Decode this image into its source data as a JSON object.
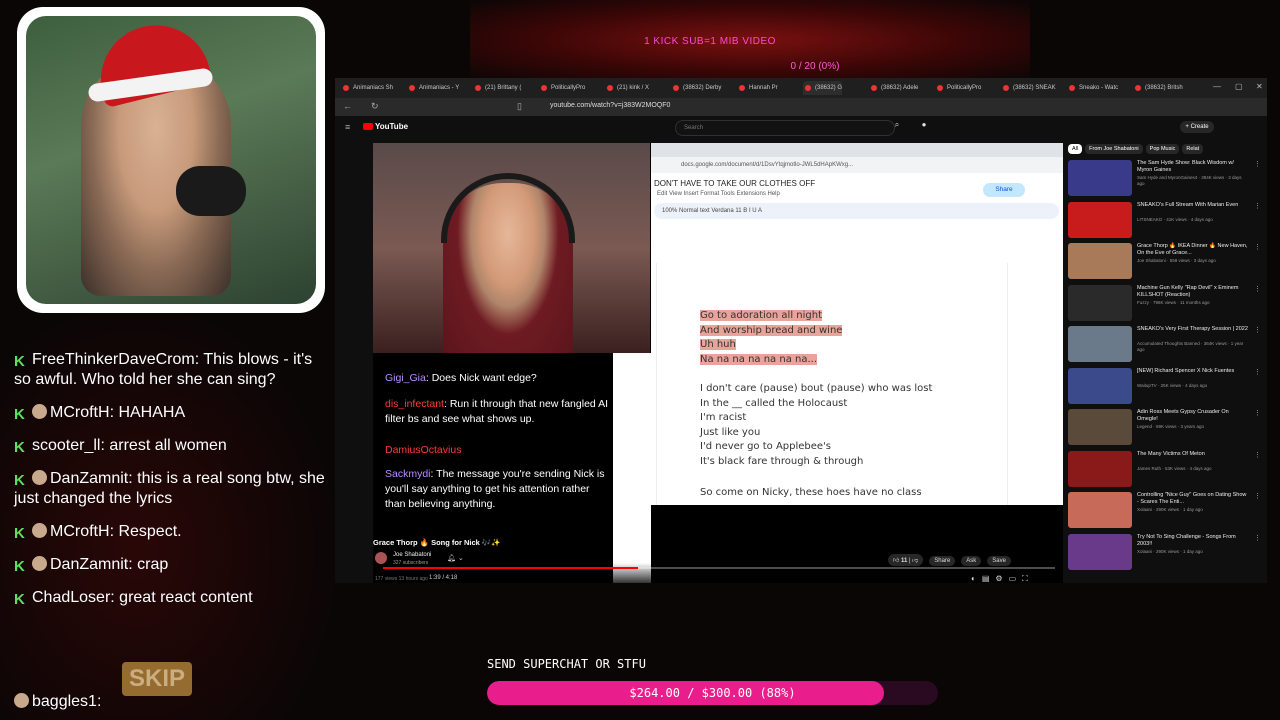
{
  "overlay": {
    "banner": "1 KICK SUB=1 MIB VIDEO",
    "sub_goal": "0 / 20 (0%)"
  },
  "chat": [
    {
      "user": "FreeThinkerDaveCrom",
      "text": "This blows - it's so awful. Who told her she can sing?"
    },
    {
      "user": "MCroftH",
      "text": "HAHAHA"
    },
    {
      "user": "scooter_ll",
      "text": "arrest all women"
    },
    {
      "user": "DanZamnit",
      "text": "this is a real song btw, she just changed the lyrics"
    },
    {
      "user": "MCroftH",
      "text": "Respect."
    },
    {
      "user": "DanZamnit",
      "text": "crap"
    },
    {
      "user": "ChadLoser",
      "text": "great react content"
    }
  ],
  "skip_label": "SKIP",
  "last_user": "baggles1:",
  "browser": {
    "tabs": [
      "Animaniacs Sh",
      "Animaniacs - Y",
      "(21) Brittany (",
      "PoliticallyPro",
      "(21) kink / X",
      "(38632) Derby",
      "Hannah Pr",
      "(38632) G",
      "(38632) Adele",
      "PoliticallyPro",
      "(38632) SNEAK",
      "Sneako - Watc",
      "(38632) Britsh"
    ],
    "url": "youtube.com/watch?v=j383W2MOQF0",
    "search_placeholder": "Search",
    "create_label": "+ Create"
  },
  "youtube_logo": "YouTube",
  "stream_chat": [
    {
      "user": "Gigi_Gia",
      "text": "Does Nick want edge?",
      "red": false
    },
    {
      "user": "dis_infectant",
      "text": "Run it through that new fangled AI filter bs and see what shows up.",
      "red": true
    },
    {
      "user": "DamiusOctavius",
      "text": "",
      "red": true
    },
    {
      "user": "Sackmydi",
      "text": "The message you're sending Nick is you'll say anything to get his attention rather than believing anything.",
      "red": false
    }
  ],
  "doc": {
    "url": "docs.google.com/document/d/1DsvYtqjmotlo-JWL5dHApKWxg...",
    "title": "DON'T HAVE TO TAKE OUR CLOTHES OFF",
    "menu": "Edit   View   Insert   Format   Tools   Extensions   Help",
    "share": "Share",
    "toolbar": "100%   Normal text   Verdana   11   B   I   U   A",
    "lyrics_highlighted": [
      "Go to adoration all night",
      "And worship bread and wine",
      "Uh huh",
      "Na na na na na na na..."
    ],
    "lyrics_plain": [
      "I don't care (pause) bout (pause) who was lost",
      "In the __ called the Holocaust",
      "I'm racist",
      "Just like you",
      "I'd never go to Applebee's",
      "It's black fare through & through"
    ],
    "lyrics_last": "So come on Nicky, these hoes have no class"
  },
  "video": {
    "time": "1:39 / 4:18",
    "progress": 0.38,
    "title": "Grace Thorp 🔥 Song for Nick 🎶✨",
    "channel": "Joe Shabatoni",
    "subs": "327 subscribers",
    "likes": "11",
    "actions": [
      "Share",
      "Ask",
      "Save"
    ],
    "views": "177 views  13 hours ago"
  },
  "sidebar": {
    "chips": [
      "All",
      "From Joe Shabatoni",
      "Pop Music",
      "Relat"
    ],
    "items": [
      {
        "title": "The Sam Hyde Show: Black Wisdom w/ Myron Gaines",
        "meta": "Sam Hyde and MyronGaines4 · 394K views · 3 days ago",
        "color": "#3a3a8a"
      },
      {
        "title": "SNEAKO's Full Stream With Marian Even",
        "meta": "LITSNEAKO · 41K views · 4 days ago",
        "color": "#c81c1c"
      },
      {
        "title": "Grace Thorp 🔥 IKEA Dinner 🔥 New Haven, On the Eve of Grace...",
        "meta": "Joe Shabatoni · 559 views · 3 days ago",
        "color": "#a87a5a"
      },
      {
        "title": "Machine Gun Kelly \"Rap Devil\" x Eminem KILLSHOT (Reaction)",
        "meta": "Fuzzy · 796K views · 11 months ago",
        "color": "#2a2a2a"
      },
      {
        "title": "SNEAKO's Very First Therapy Session | 2022",
        "meta": "Accumulated Thoughts Banned · 364K views · 1 year ago",
        "color": "#6a7a8a"
      },
      {
        "title": "[NEW] Richard Spencer X Nick Fuentes",
        "meta": "WaitupTV · 25K views · 4 days ago",
        "color": "#3a4a8a"
      },
      {
        "title": "Adin Ross Meets Gypsy Crusader On Omegle!",
        "meta": "Legend · 69K views · 3 years ago",
        "color": "#5a4a3a"
      },
      {
        "title": "The Many Victims Of Meton",
        "meta": "James Ruth · 53K views · 4 days ago",
        "color": "#8a1a1a"
      },
      {
        "title": "Controlling \"Nice Guy\" Goes on Dating Show - Scares The Enti...",
        "meta": "Xolaani · 290K views · 1 day ago",
        "color": "#c86a5a"
      },
      {
        "title": "Try Not To Sing Challenge - Songs From 2003!!",
        "meta": "Xolaani · 290K views · 1 day ago",
        "color": "#6a3a8a"
      }
    ]
  },
  "superchat": {
    "label": "SEND SUPERCHAT OR STFU",
    "goal_text": "$264.00 / $300.00 (88%)",
    "progress": 0.88
  }
}
